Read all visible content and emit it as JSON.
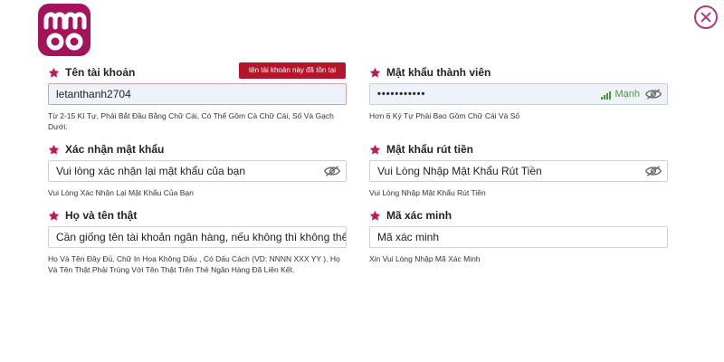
{
  "brand": {
    "logo_icon": "mmoo-logo-icon",
    "color": "#a3145c"
  },
  "close_icon": "close-icon",
  "accent_color": "#c2185b",
  "error_color": "#b3162b",
  "fields": {
    "username": {
      "label": "Tên tài khoản",
      "value": "letanthanh2704",
      "error": "tên tài khoản này đã tồn tại",
      "hint": "Từ 2-15 Kí Tự, Phải Bắt Đầu Bằng Chữ Cái, Có Thể Gồm Cả Chữ Cái, Số Và Gạch Dưới."
    },
    "password": {
      "label": "Mật khẩu thành viên",
      "value": "•••••••••••",
      "strength": "Mạnh",
      "hint": "Hơn 6 Ký Tự Phải Bao Gồm Chữ Cái Và Số"
    },
    "confirm_password": {
      "label": "Xác nhận mật khẩu",
      "placeholder": "Vui lòng xác nhận lại mật khẩu của bạn",
      "hint": "Vui Lòng Xác Nhận Lại Mật Khẩu Của Bạn"
    },
    "withdraw_password": {
      "label": "Mật khẩu rút tiền",
      "placeholder": "Vui Lòng Nhập Mật Khẩu Rút Tiền",
      "hint": "Vui Lòng Nhập Mật Khẩu Rút Tiền"
    },
    "full_name": {
      "label": "Họ và tên thật",
      "placeholder": "Cần giống tên tài khoản ngân hàng, nếu không thì không thể rút tiền",
      "hint": "Họ Và Tên Đầy Đủ, Chữ In Hoa Không Dấu , Có Dấu Cách (VD: NNNN XXX YY ). Họ Và Tên Thật Phải Trùng Với Tên Thật Trên Thẻ Ngân Hàng Đã Liên Kết."
    },
    "captcha": {
      "label": "Mã xác minh",
      "placeholder": "Mã xác minh",
      "hint": "Xin Vui Lòng Nhập Mã Xác Minh"
    }
  }
}
